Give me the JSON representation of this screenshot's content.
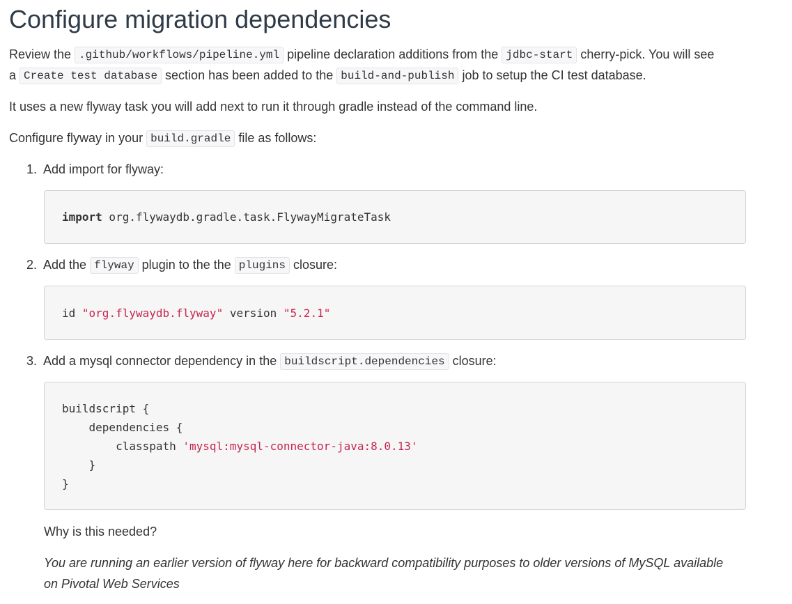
{
  "title": "Configure migration dependencies",
  "intro": {
    "t1": "Review the ",
    "c1": ".github/workflows/pipeline.yml",
    "t2": " pipeline declaration additions from the ",
    "c2": "jdbc-start",
    "t3": " cherry-pick. You will see",
    "t4": "a ",
    "c3": "Create test database",
    "t5": " section has been added to the ",
    "c4": "build-and-publish",
    "t6": " job to setup the CI test database."
  },
  "para2": "It uses a new flyway task you will add next to run it through gradle instead of the command line.",
  "para3": {
    "t1": "Configure flyway in your ",
    "c1": "build.gradle",
    "t2": " file as follows:"
  },
  "steps": [
    {
      "num": "1.",
      "t1": "Add import for flyway:",
      "code": {
        "kw": "import",
        "rest": " org.flywaydb.gradle.task.FlywayMigrateTask"
      }
    },
    {
      "num": "2.",
      "t1": "Add the ",
      "c1": "flyway",
      "t2": " plugin to the the ",
      "c2": "plugins",
      "t3": " closure:",
      "code": {
        "a": "id ",
        "s1": "\"org.flywaydb.flyway\"",
        "b": " version ",
        "s2": "\"5.2.1\""
      }
    },
    {
      "num": "3.",
      "t1": "Add a mysql connector dependency in the ",
      "c1": "buildscript.dependencies",
      "t2": " closure:",
      "code": {
        "l1": "buildscript {",
        "l2": "    dependencies {",
        "l3a": "        classpath ",
        "l3s": "'mysql:mysql-connector-java:8.0.13'",
        "l4": "    }",
        "l5": "}"
      }
    }
  ],
  "why_question": "Why is this needed?",
  "why_answer": "You are running an earlier version of flyway here for backward compatibility purposes to older versions of MySQL available on Pivotal Web Services"
}
